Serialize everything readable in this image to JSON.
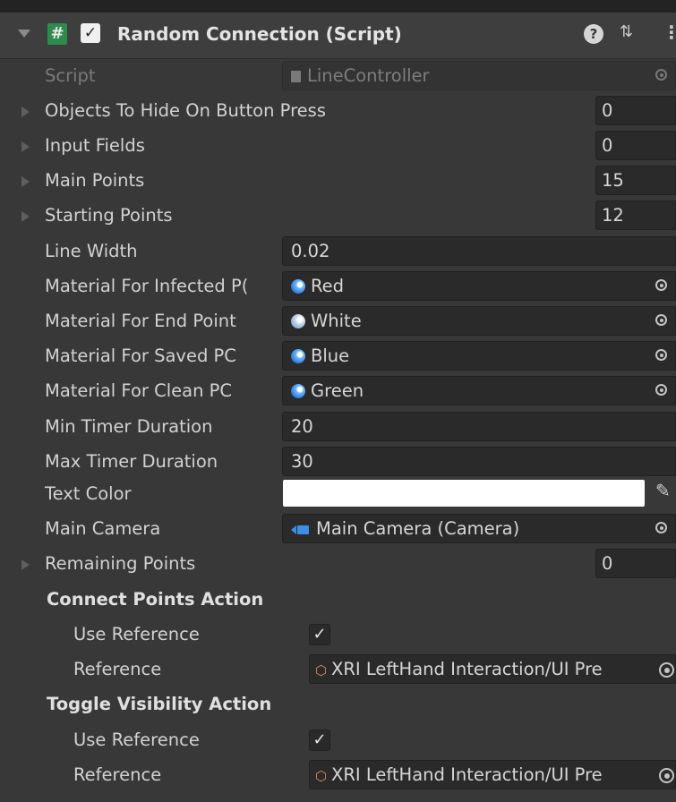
{
  "component": {
    "title": "Random Connection (Script)",
    "icons": [
      "script-hash-icon",
      "help-icon",
      "presets-icon",
      "kebab-menu-icon"
    ]
  },
  "fields": {
    "script": {
      "label": "Script",
      "value": "LineController"
    },
    "objects_to_hide": {
      "label": "Objects To Hide On Button Press",
      "count": "0"
    },
    "input_fields": {
      "label": "Input Fields",
      "count": "0"
    },
    "main_points": {
      "label": "Main Points",
      "count": "15"
    },
    "starting_points": {
      "label": "Starting Points",
      "count": "12"
    },
    "line_width": {
      "label": "Line Width",
      "value": "0.02"
    },
    "mat_infected": {
      "label": "Material For Infected P(",
      "value": "Red"
    },
    "mat_end": {
      "label": "Material For End Point",
      "value": "White"
    },
    "mat_saved": {
      "label": "Material For Saved PC",
      "value": "Blue"
    },
    "mat_clean": {
      "label": "Material For Clean PC",
      "value": "Green"
    },
    "min_timer": {
      "label": "Min Timer Duration",
      "value": "20"
    },
    "max_timer": {
      "label": "Max Timer Duration",
      "value": "30"
    },
    "text_color": {
      "label": "Text Color",
      "color": "#ffffff"
    },
    "main_camera": {
      "label": "Main Camera",
      "value": "Main Camera (Camera)"
    },
    "remaining_points": {
      "label": "Remaining Points",
      "count": "0"
    }
  },
  "connect_action": {
    "header": "Connect Points Action",
    "use_reference_label": "Use Reference",
    "use_reference_checked": true,
    "reference_label": "Reference",
    "reference_value": "XRI LeftHand Interaction/UI Pre"
  },
  "toggle_action": {
    "header": "Toggle Visibility Action",
    "use_reference_label": "Use Reference",
    "use_reference_checked": true,
    "reference_label": "Reference",
    "reference_value": "XRI LeftHand Interaction/UI Pre"
  },
  "colors": {
    "background": "#383838",
    "field": "#2a2a2a",
    "script_icon": "#2f8a4e",
    "object_icon": "#3d8ee8"
  }
}
